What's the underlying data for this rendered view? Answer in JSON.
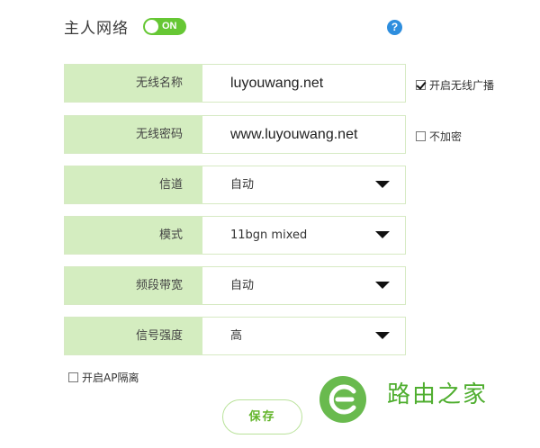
{
  "header": {
    "title": "主人网络",
    "toggle_label": "ON",
    "help_label": "?"
  },
  "rows": [
    {
      "label": "无线名称",
      "value": "luyouwang.net"
    },
    {
      "label": "无线密码",
      "value": "www.luyouwang.net"
    },
    {
      "label": "信道",
      "value": "自动"
    },
    {
      "label": "模式",
      "value": "11bgn mixed"
    },
    {
      "label": "频段带宽",
      "value": "自动"
    },
    {
      "label": "信号强度",
      "value": "高"
    }
  ],
  "options": {
    "broadcast_label": "开启无线广播",
    "broadcast_checked": true,
    "no_encrypt_label": "不加密",
    "no_encrypt_checked": false,
    "ap_isolation_label": "开启AP隔离",
    "ap_isolation_checked": false
  },
  "save_label": "保存",
  "watermark": {
    "text": "路由之家"
  },
  "colors": {
    "accent": "#66c734",
    "label_bg": "#d4edc0",
    "help": "#2e8ede"
  }
}
